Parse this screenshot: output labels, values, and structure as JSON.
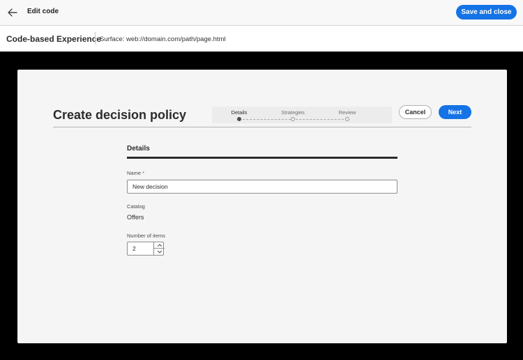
{
  "header": {
    "back_icon": "arrow-left-icon",
    "title": "Edit code",
    "save_close_label": "Save and close"
  },
  "subheader": {
    "title": "Code-based Experience",
    "surface": "Surface: web://domain.com/path/page.html"
  },
  "dialog": {
    "title": "Create decision policy",
    "steps": [
      {
        "label": "Details",
        "active": true
      },
      {
        "label": "Strategies",
        "active": false
      },
      {
        "label": "Review",
        "active": false
      }
    ],
    "cancel_label": "Cancel",
    "next_label": "Next",
    "section_title": "Details",
    "name": {
      "label": "Name",
      "required_mark": "*",
      "value": "New decision"
    },
    "catalog": {
      "label": "Catalog",
      "value": "Offers"
    },
    "number_of_items": {
      "label": "Number of items",
      "value": "2"
    }
  },
  "colors": {
    "accent": "#1473e6",
    "backdrop": "#000000",
    "dialog_bg": "#f5f5f5"
  }
}
